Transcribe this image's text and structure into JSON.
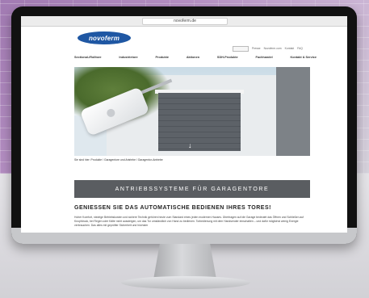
{
  "browser": {
    "url": "novoferm.de"
  },
  "brand": {
    "logo_text": "novoferm",
    "logo_color": "#1f57a3"
  },
  "utility_nav": [
    "Presse",
    "Novoferm.com",
    "Kontakt",
    "FAQ"
  ],
  "main_nav": [
    "Sectional-/Rolltore",
    "Industrietore",
    "Produkte",
    "Aktionen",
    "SDH-Produkte",
    "Fachhandel",
    "Kontakt & Service"
  ],
  "hero": {
    "icon": "arrow-down-icon"
  },
  "breadcrumb": "Sie sind hier: Produkte / Garagentore und Antriebe / Garagentor-Antriebe",
  "banner": {
    "text": "ANTRIEBSSYSTEME FÜR GARAGENTORE",
    "color": "#5a5d61"
  },
  "section": {
    "title": "GENIESSEN SIE DAS AUTOMATISCHE BEDIENEN IHRES TORES!",
    "body": "Hoher Komfort, niedrige Betriebskosten und sichere Technik gehören heute zum Standard eines jeden modernen Hauses. Übertragen auf die Garage bedeutet das Öffnen und Schließen auf Knopfdruck, bei Regen oder Kälte nicht aussteigen, um das Tor umständlich von Hand zu bedienen. Torbedienung mit dem Handsender einschalten – und dafür möglichst wenig Energie verbrauchen. Das alles mit geprüfter Sicherheit und höchster"
  }
}
